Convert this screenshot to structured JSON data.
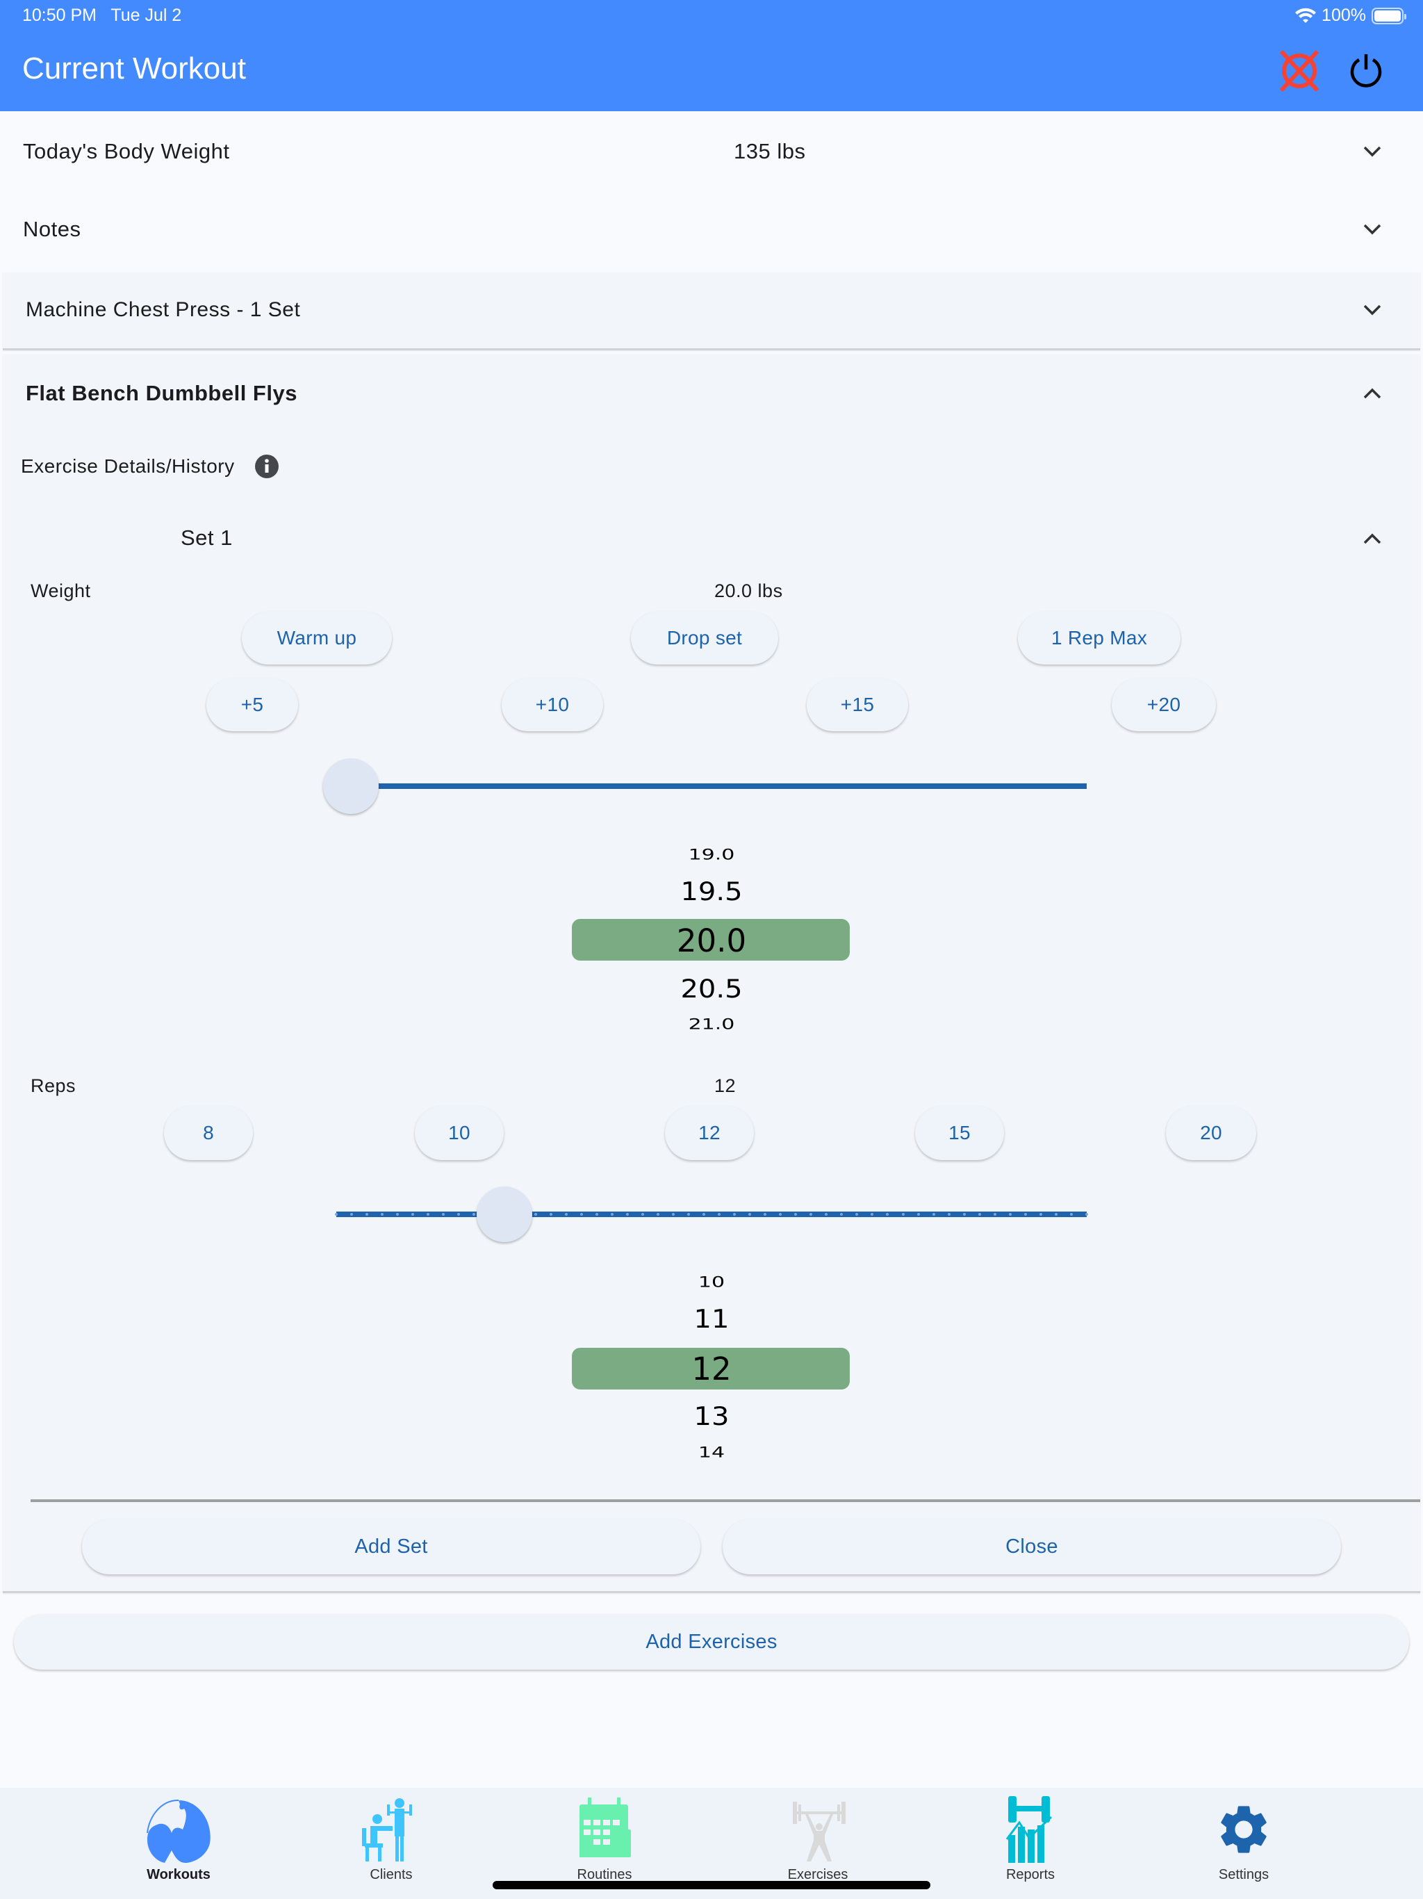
{
  "status_bar": {
    "time": "10:50 PM",
    "date": "Tue Jul 2",
    "battery": "100%",
    "wifi_icon": "wifi-icon",
    "battery_icon": "battery-icon"
  },
  "header": {
    "title": "Current Workout",
    "actions": [
      {
        "name": "cancel-workout",
        "icon": "cancel-x-circle-icon",
        "color": "#f44336"
      },
      {
        "name": "power",
        "icon": "power-icon",
        "color": "#000000"
      }
    ],
    "background": "#448aff"
  },
  "body_weight": {
    "label": "Today's Body Weight",
    "value": "135 lbs"
  },
  "notes": {
    "label": "Notes"
  },
  "exercises": [
    {
      "title": "Machine Chest Press - 1 Set",
      "expanded": false
    },
    {
      "title": "Flat Bench Dumbbell Flys",
      "expanded": true,
      "details_label": "Exercise Details/History",
      "sets": [
        {
          "label": "Set 1",
          "weight": {
            "label": "Weight",
            "value": "20.0 lbs",
            "presets": [
              "Warm up",
              "Drop set",
              "1 Rep Max"
            ],
            "increments": [
              "+5",
              "+10",
              "+15",
              "+20"
            ],
            "slider_value": 20.0,
            "slider_min": 20.0,
            "slider_max": 500.0,
            "picker": [
              "19.0",
              "19.5",
              "20.0",
              "20.5",
              "21.0"
            ],
            "picker_selected_index": 2
          },
          "reps": {
            "label": "Reps",
            "value": "12",
            "quick_values": [
              "8",
              "10",
              "12",
              "15",
              "20"
            ],
            "slider_value": 12,
            "slider_min": 1,
            "slider_max": 50,
            "picker": [
              "10",
              "11",
              "12",
              "13",
              "14"
            ],
            "picker_selected_index": 2
          }
        }
      ],
      "add_set_label": "Add Set",
      "close_label": "Close"
    }
  ],
  "add_exercises_label": "Add Exercises",
  "colors": {
    "accent_text": "#1d63ab",
    "picker_highlight": "#7bab82",
    "slider": "#1d64ac"
  },
  "tabs": [
    {
      "label": "Workouts",
      "icon": "flexed-arm-icon",
      "active": true
    },
    {
      "label": "Clients",
      "icon": "trainer-client-icon",
      "active": false
    },
    {
      "label": "Routines",
      "icon": "calendar-dumbbell-icon",
      "active": false
    },
    {
      "label": "Exercises",
      "icon": "weightlifter-icon",
      "active": false
    },
    {
      "label": "Reports",
      "icon": "dumbbell-chart-icon",
      "active": false
    },
    {
      "label": "Settings",
      "icon": "gear-icon",
      "active": false
    }
  ]
}
